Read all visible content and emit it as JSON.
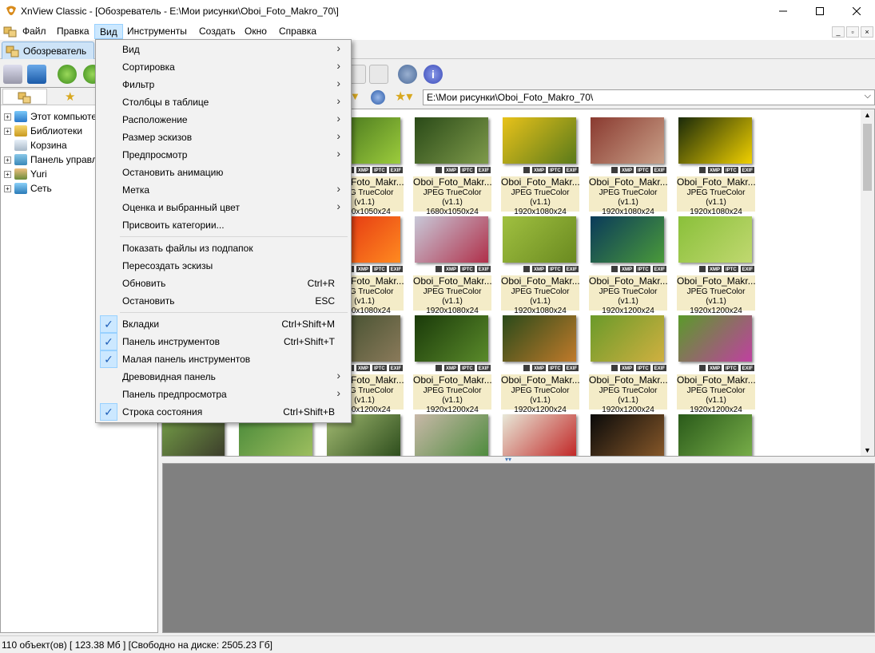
{
  "window": {
    "title": "XnView Classic - [Обозреватель - E:\\Мои рисунки\\Oboi_Foto_Makro_70\\]",
    "controls": [
      "minimize",
      "maximize",
      "close"
    ]
  },
  "menubar": {
    "items": [
      "Файл",
      "Правка",
      "Вид",
      "Инструменты",
      "Создать",
      "Окно",
      "Справка"
    ],
    "active": "Вид"
  },
  "tabs": [
    {
      "label": "Обозреватель"
    }
  ],
  "address": {
    "path": "E:\\Мои рисунки\\Oboi_Foto_Makro_70\\"
  },
  "tree": {
    "items": [
      {
        "label": "Этот компьютер",
        "icon": "computer-icon",
        "expandable": true
      },
      {
        "label": "Библиотеки",
        "icon": "libraries-icon",
        "expandable": true
      },
      {
        "label": "Корзина",
        "icon": "recycle-bin-icon",
        "expandable": false
      },
      {
        "label": "Панель управления",
        "icon": "control-panel-icon",
        "expandable": true
      },
      {
        "label": "Yuri",
        "icon": "user-icon",
        "expandable": true
      },
      {
        "label": "Сеть",
        "icon": "network-icon",
        "expandable": true
      }
    ]
  },
  "view_menu": {
    "items": [
      {
        "label": "Вид",
        "submenu": true
      },
      {
        "label": "Сортировка",
        "submenu": true
      },
      {
        "label": "Фильтр",
        "submenu": true
      },
      {
        "label": "Столбцы в таблице",
        "submenu": true
      },
      {
        "label": "Расположение",
        "submenu": true
      },
      {
        "label": "Размер эскизов",
        "submenu": true
      },
      {
        "label": "Предпросмотр",
        "submenu": true
      },
      {
        "label": "Остановить анимацию"
      },
      {
        "label": "Метка",
        "submenu": true
      },
      {
        "label": "Оценка и выбранный цвет",
        "submenu": true
      },
      {
        "label": "Присвоить категории..."
      },
      {
        "separator": true
      },
      {
        "label": "Показать файлы из подпапок"
      },
      {
        "label": "Пересоздать эскизы"
      },
      {
        "label": "Обновить",
        "shortcut": "Ctrl+R"
      },
      {
        "label": "Остановить",
        "shortcut": "ESC"
      },
      {
        "separator": true
      },
      {
        "label": "Вкладки",
        "shortcut": "Ctrl+Shift+M",
        "checked": true
      },
      {
        "label": "Панель инструментов",
        "shortcut": "Ctrl+Shift+T",
        "checked": true
      },
      {
        "label": "Малая панель инструментов",
        "checked": true
      },
      {
        "label": "Древовидная панель",
        "submenu": true
      },
      {
        "label": "Панель предпросмотра",
        "submenu": true
      },
      {
        "label": "Строка состояния",
        "shortcut": "Ctrl+Shift+B",
        "checked": true
      }
    ]
  },
  "thumbnails": {
    "badges": [
      "XMP",
      "IPTC",
      "EXIF"
    ],
    "rows": [
      [
        {
          "name": "Oboi_Foto_Makr...",
          "type": "JPEG TrueColor (v1.1)",
          "size": "1680x1050x24",
          "color1": "#3d6b1a",
          "color2": "#9ccc3c"
        },
        {
          "name": "Oboi_Foto_Makr...",
          "type": "JPEG TrueColor (v1.1)",
          "size": "1680x1050x24",
          "color1": "#2a4a18",
          "color2": "#7e9a4a"
        },
        {
          "name": "Oboi_Foto_Makr...",
          "type": "JPEG TrueColor (v1.1)",
          "size": "1920x1080x24",
          "color1": "#e8c21a",
          "color2": "#5a7a1a"
        },
        {
          "name": "Oboi_Foto_Makr...",
          "type": "JPEG TrueColor (v1.1)",
          "size": "1920x1080x24",
          "color1": "#8a3a30",
          "color2": "#c9a088"
        },
        {
          "name": "Oboi_Foto_Makr...",
          "type": "JPEG TrueColor (v1.1)",
          "size": "1920x1080x24",
          "color1": "#1a2a0a",
          "color2": "#f0d000"
        }
      ],
      [
        {
          "name": "Oboi_Foto_Makr...",
          "type": "JPEG TrueColor (v1.1)",
          "size": "1920x1080x24",
          "color1": "#e02a10",
          "color2": "#ff8a20"
        },
        {
          "name": "Oboi_Foto_Makr...",
          "type": "JPEG TrueColor (v1.1)",
          "size": "1920x1080x24",
          "color1": "#c8c8d8",
          "color2": "#b0304a"
        },
        {
          "name": "Oboi_Foto_Makr...",
          "type": "JPEG TrueColor (v1.1)",
          "size": "1920x1080x24",
          "color1": "#a0c040",
          "color2": "#6a8a20"
        },
        {
          "name": "Oboi_Foto_Makr...",
          "type": "JPEG TrueColor (v1.1)",
          "size": "1920x1200x24",
          "color1": "#0a3a5a",
          "color2": "#4a9a3a"
        },
        {
          "name": "Oboi_Foto_Makr...",
          "type": "JPEG TrueColor (v1.1)",
          "size": "1920x1200x24",
          "color1": "#8ac03a",
          "color2": "#c0d870"
        }
      ],
      [
        {
          "name": "Oboi_Foto_Makr...",
          "type": "JPEG TrueColor (v1.1)",
          "size": "1920x1200x24",
          "color1": "#3a4a2a",
          "color2": "#8a7a5a"
        },
        {
          "name": "Oboi_Foto_Makr...",
          "type": "JPEG TrueColor (v1.1)",
          "size": "1920x1200x24",
          "color1": "#1a3a0a",
          "color2": "#5a8a2a"
        },
        {
          "name": "Oboi_Foto_Makr...",
          "type": "JPEG TrueColor (v1.1)",
          "size": "1920x1200x24",
          "color1": "#2a4a1a",
          "color2": "#c07a2a"
        },
        {
          "name": "Oboi_Foto_Makr...",
          "type": "JPEG TrueColor (v1.1)",
          "size": "1920x1200x24",
          "color1": "#6a9a2a",
          "color2": "#d0b040"
        },
        {
          "name": "Oboi_Foto_Makr...",
          "type": "JPEG TrueColor (v1.1)",
          "size": "1920x1200x24",
          "color1": "#5a9a2a",
          "color2": "#c040a0"
        }
      ],
      [
        {
          "color1": "#7aa84a",
          "color2": "#3a3a2a"
        },
        {
          "color1": "#4a8a3a",
          "color2": "#a0c060"
        },
        {
          "color1": "#a0b870",
          "color2": "#2a4a1a"
        },
        {
          "color1": "#c8b8a8",
          "color2": "#4a8a3a"
        },
        {
          "color1": "#e8e8d8",
          "color2": "#c02020"
        },
        {
          "color1": "#0a0a0a",
          "color2": "#8a5a2a"
        },
        {
          "color1": "#2a5a1a",
          "color2": "#7ab04a"
        }
      ]
    ],
    "first_rows_left_partial": true
  },
  "status": {
    "text": "110 объект(ов) [ 123.38 Мб ] [Свободно на диске: 2505.23 Гб]"
  }
}
